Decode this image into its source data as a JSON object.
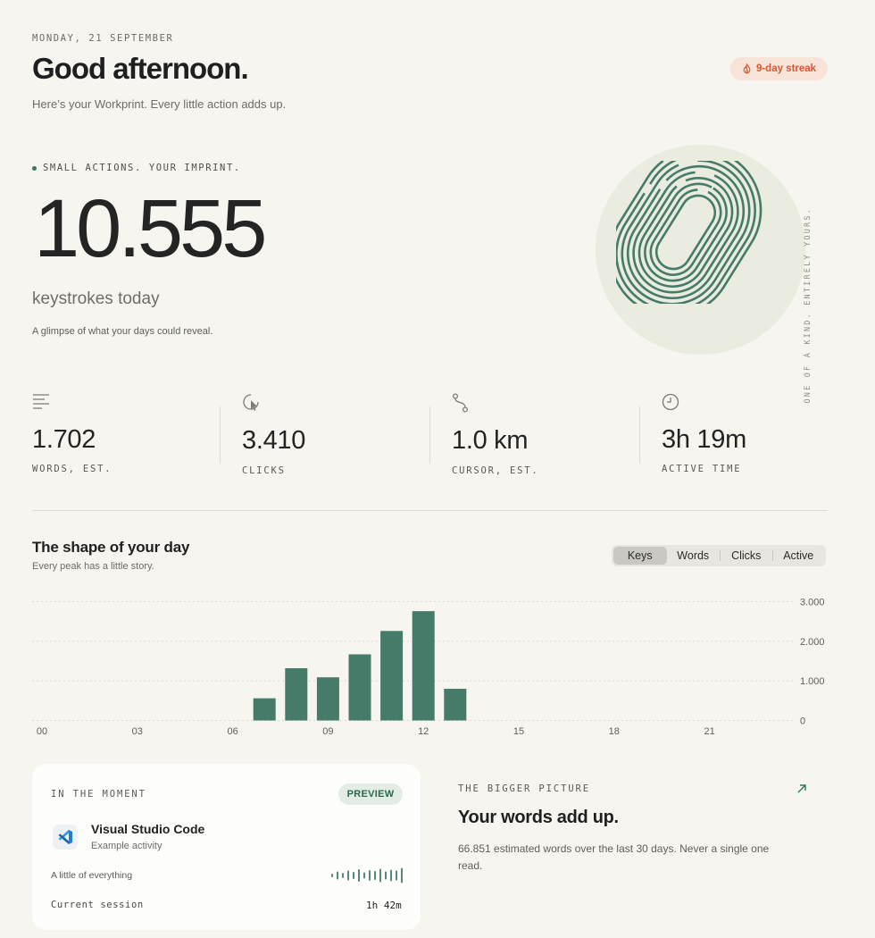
{
  "header": {
    "date": "MONDAY, 21 SEPTEMBER",
    "greeting": "Good afternoon.",
    "subtitle": "Here’s your Workprint. Every little action adds up.",
    "streak": "9-day streak"
  },
  "hero": {
    "eyebrow": "SMALL ACTIONS. YOUR IMPRINT.",
    "number": "10.555",
    "unit": "keystrokes today",
    "caption": "A glimpse of what your days could reveal.",
    "side_caption": "ONE OF A KIND. ENTIRELY YOURS."
  },
  "stats": [
    {
      "value": "1.702",
      "label": "WORDS, EST.",
      "icon": "lines-icon"
    },
    {
      "value": "3.410",
      "label": "CLICKS",
      "icon": "cursor-click-icon"
    },
    {
      "value": "1.0 km",
      "label": "CURSOR, EST.",
      "icon": "path-icon"
    },
    {
      "value": "3h 19m",
      "label": "ACTIVE TIME",
      "icon": "clock-icon"
    }
  ],
  "chart_section": {
    "title": "The shape of your day",
    "subtitle": "Every peak has a little story.",
    "tabs": [
      "Keys",
      "Words",
      "Clicks",
      "Active"
    ],
    "active_tab": "Keys"
  },
  "chart_data": {
    "type": "bar",
    "x": [
      7,
      8,
      9,
      10,
      11,
      12,
      13
    ],
    "values": [
      560,
      1320,
      1090,
      1670,
      2260,
      2760,
      800
    ],
    "x_ticks": [
      "00",
      "03",
      "06",
      "09",
      "12",
      "15",
      "18",
      "21"
    ],
    "y_ticks": [
      "3.000",
      "2.000",
      "1.000",
      "0"
    ],
    "xlim": [
      0,
      24
    ],
    "ylim": [
      0,
      3000
    ],
    "grid": true,
    "color": "#477b69"
  },
  "moment": {
    "eyebrow": "IN THE MOMENT",
    "badge": "PREVIEW",
    "app_name": "Visual Studio Code",
    "app_activity": "Example activity",
    "mix_label": "A little of everything",
    "session_label": "Current session",
    "session_value": "1h 42m"
  },
  "bigger_picture": {
    "eyebrow": "THE BIGGER PICTURE",
    "title": "Your words add up.",
    "text": "66.851 estimated words over the last 30 days. Never a single one read."
  },
  "colors": {
    "accent": "#477b69",
    "streak": "#d9582f",
    "background": "#f7f5f0"
  }
}
